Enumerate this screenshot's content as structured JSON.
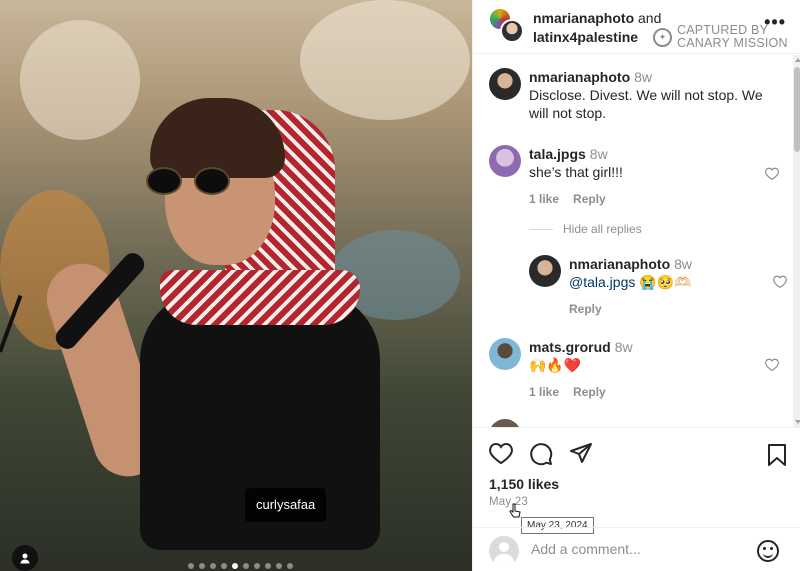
{
  "post": {
    "author": "nmarianaphoto",
    "and_text": "and",
    "coauthor": "latinx4palestine",
    "watermark": "CAPTURED BY\nCANARY MISSION",
    "more_icon": "more-horizontal-icon",
    "photo_tag": "curlysafaa",
    "carousel_count": 10,
    "carousel_active": 4
  },
  "comments": [
    {
      "user": "nmarianaphoto",
      "time": "8w",
      "text": "Disclose. Divest. We will not stop. We will not stop.",
      "has_meta": false
    },
    {
      "user": "tala.jpgs",
      "time": "8w",
      "text": "she’s that girl!!!",
      "likes": "1 like",
      "reply": "Reply"
    },
    {
      "user": "nmarianaphoto",
      "time": "8w",
      "text": "@tala.jpgs 😭🥺🫶🏻",
      "reply": "Reply"
    },
    {
      "user": "mats.grorud",
      "time": "8w",
      "text": "🙌🔥❤️",
      "likes": "1 like",
      "reply": "Reply"
    }
  ],
  "hide_replies": "Hide all replies",
  "actions": {
    "like_icon": "heart-icon",
    "comment_icon": "comment-icon",
    "share_icon": "share-icon",
    "save_icon": "bookmark-icon",
    "likes": "1,150 likes",
    "date": "May 23",
    "date_tooltip": "May 23, 2024"
  },
  "add_comment": {
    "placeholder": "Add a comment...",
    "emoji_icon": "smiley-icon"
  }
}
